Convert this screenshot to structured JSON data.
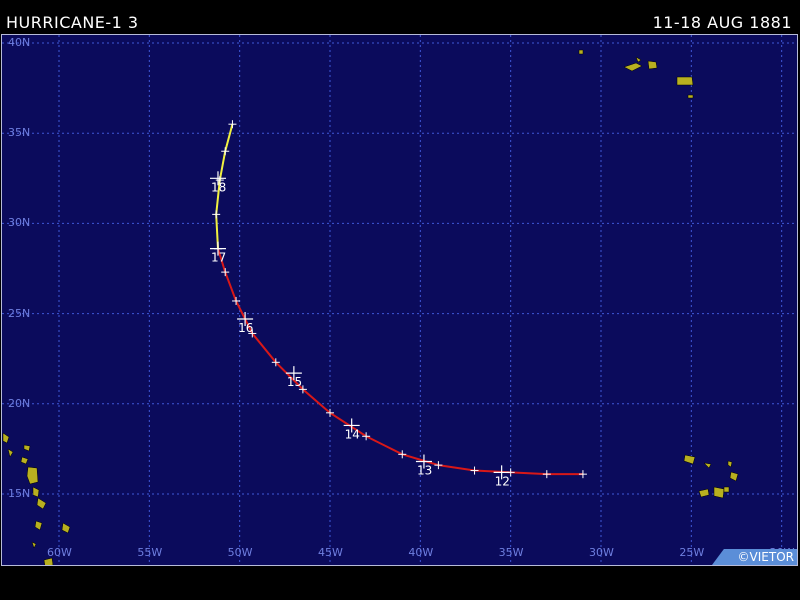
{
  "header": {
    "title": "HURRICANE-1 3",
    "dates": "11-18 AUG 1881"
  },
  "map": {
    "lat_labels": [
      "40N",
      "35N",
      "30N",
      "25N",
      "20N",
      "15N"
    ],
    "lon_labels": [
      "60W",
      "55W",
      "50W",
      "45W",
      "40W",
      "35W",
      "30W",
      "25W",
      "20W"
    ],
    "grid_color": "#3f58d8",
    "ocean_color": "#0b0b5c",
    "land_color": "#b8b020"
  },
  "track": {
    "hurricane_color": "#d81818",
    "weaker_color": "#f0f040",
    "day_labels": [
      "12",
      "13",
      "14",
      "15",
      "16",
      "17",
      "18"
    ]
  },
  "credit": "©VIETOR",
  "chart_data": {
    "type": "map-track",
    "title": "HURRICANE-1 3",
    "dates": "11-18 AUG 1881",
    "lon_range": [
      -62,
      -18
    ],
    "lat_range": [
      12,
      40
    ],
    "segments": [
      {
        "intensity": "hurricane",
        "color": "#d81818",
        "points": [
          [
            -31,
            16.1
          ],
          [
            -33,
            16.1
          ],
          [
            -35,
            16.2
          ],
          [
            -37,
            16.3
          ],
          [
            -39,
            16.6
          ],
          [
            -41,
            17.2
          ],
          [
            -43,
            18.2
          ],
          [
            -45,
            19.5
          ],
          [
            -46.5,
            20.8
          ],
          [
            -48,
            22.3
          ],
          [
            -49.3,
            23.9
          ],
          [
            -50.2,
            25.7
          ],
          [
            -50.8,
            27.3
          ],
          [
            -51.2,
            28.6
          ]
        ]
      },
      {
        "intensity": "tropical storm",
        "color": "#f0f040",
        "points": [
          [
            -51.2,
            28.6
          ],
          [
            -51.3,
            30.5
          ],
          [
            -51.1,
            32.4
          ],
          [
            -50.8,
            34.0
          ],
          [
            -50.4,
            35.5
          ]
        ]
      }
    ],
    "day_markers": [
      {
        "label": "12",
        "lon": -35.5,
        "lat": 16.2
      },
      {
        "label": "13",
        "lon": -39.8,
        "lat": 16.8
      },
      {
        "label": "14",
        "lon": -43.8,
        "lat": 18.8
      },
      {
        "label": "15",
        "lon": -47.0,
        "lat": 21.7
      },
      {
        "label": "16",
        "lon": -49.7,
        "lat": 24.7
      },
      {
        "label": "17",
        "lon": -51.2,
        "lat": 28.6
      },
      {
        "label": "18",
        "lon": -51.2,
        "lat": 32.5
      }
    ]
  }
}
